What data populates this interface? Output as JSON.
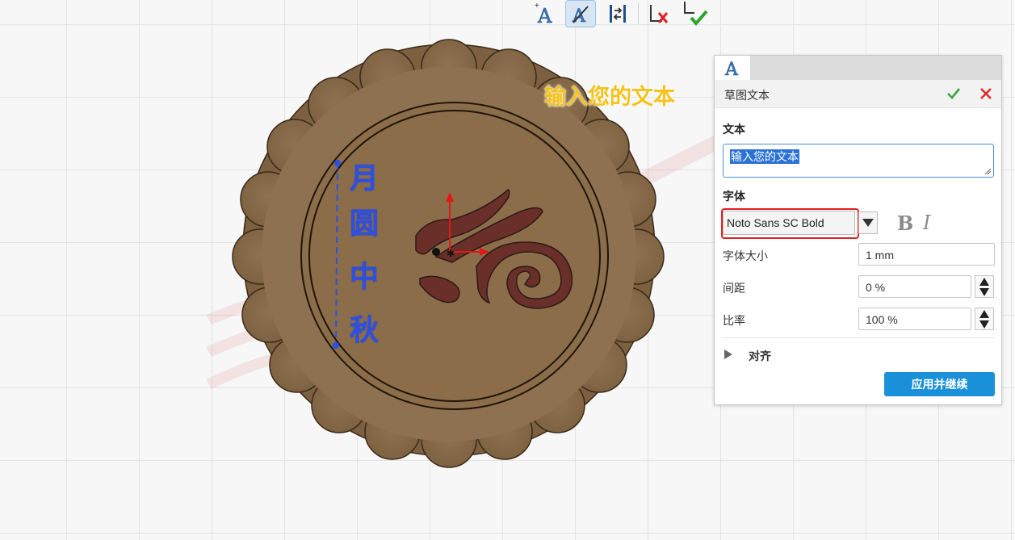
{
  "viewport": {
    "preview_text": "输入您的文本",
    "sketch_text_chars": [
      "月",
      "圆",
      "中",
      "秋"
    ]
  },
  "toolbar": {
    "tools": [
      {
        "name": "text-tool-icon"
      },
      {
        "name": "edit-text-tool-icon",
        "active": true
      },
      {
        "name": "flip-tool-icon"
      },
      {
        "name": "cancel-sketch-icon"
      },
      {
        "name": "finish-sketch-icon"
      }
    ]
  },
  "panel": {
    "tab_icon": "text-tab-icon",
    "title": "草图文本",
    "text_section": {
      "label": "文本",
      "value": "输入您的文本"
    },
    "font_section": {
      "label": "字体",
      "font_value": "Noto Sans SC Bold",
      "bold_label": "B",
      "italic_label": "I"
    },
    "font_size": {
      "label": "字体大小",
      "value": "1 mm"
    },
    "spacing": {
      "label": "间距",
      "value": "0 %"
    },
    "ratio": {
      "label": "比率",
      "value": "100 %"
    },
    "align": {
      "label": "对齐"
    },
    "apply_label": "应用并继续"
  },
  "colors": {
    "accent": "#1a90d8",
    "highlight": "#e02020",
    "mooncake": "#8b6d4a",
    "sketch_blue": "#2d50e0",
    "preview_yellow": "#f4c21b"
  }
}
